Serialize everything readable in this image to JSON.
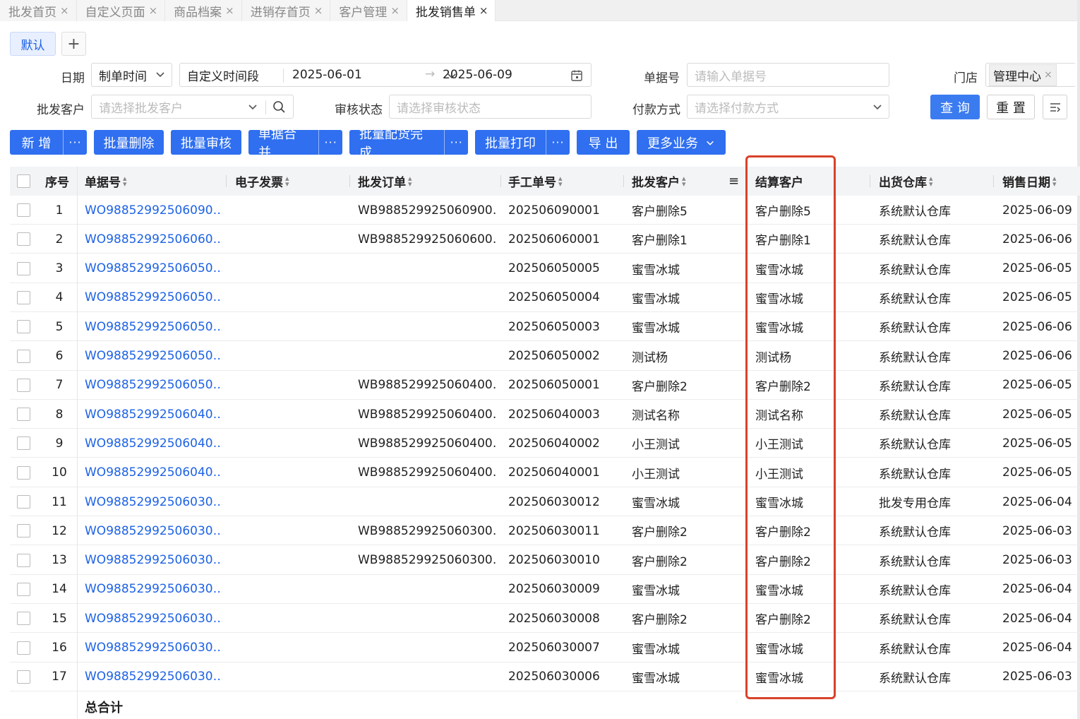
{
  "tabs": [
    {
      "label": "批发首页",
      "active": false
    },
    {
      "label": "自定义页面",
      "active": false
    },
    {
      "label": "商品档案",
      "active": false
    },
    {
      "label": "进销存首页",
      "active": false
    },
    {
      "label": "客户管理",
      "active": false
    },
    {
      "label": "批发销售单",
      "active": true
    }
  ],
  "tab_close": "×",
  "view": {
    "default_label": "默认",
    "add_label": "+"
  },
  "filters": {
    "date_label": "日期",
    "date_type": "制单时间",
    "date_range_type": "自定义时间段",
    "date_start": "2025-06-01",
    "date_arrow": "→",
    "date_end": "2025-06-09",
    "doc_no_label": "单据号",
    "doc_no_placeholder": "请输入单据号",
    "store_label": "门店",
    "store_value": "管理中心",
    "store_close": "×",
    "customer_label": "批发客户",
    "customer_placeholder": "请选择批发客户",
    "audit_label": "审核状态",
    "audit_placeholder": "请选择审核状态",
    "payment_label": "付款方式",
    "payment_placeholder": "请选择付款方式",
    "query": "查 询",
    "reset": "重 置"
  },
  "toolbar": {
    "add": "新 增",
    "batch_delete": "批量删除",
    "batch_audit": "批量审核",
    "merge": "单据合并",
    "batch_allocate": "批量配货完成",
    "batch_print": "批量打印",
    "export": "导 出",
    "more_business": "更多业务",
    "more_dots": "···"
  },
  "table": {
    "headers": {
      "seq": "序号",
      "doc_no": "单据号",
      "invoice": "电子发票",
      "order": "批发订单",
      "manual_no": "手工单号",
      "customer": "批发客户",
      "settle_customer": "结算客户",
      "warehouse": "出货仓库",
      "sale_date": "销售日期"
    },
    "rows": [
      {
        "seq": "1",
        "doc_no": "WO98852992506090…",
        "invoice": "",
        "order": "WB988529925060900…",
        "manual_no": "202506090001",
        "customer": "客户删除5",
        "settle": "客户删除5",
        "warehouse": "系统默认仓库",
        "date": "2025-06-09"
      },
      {
        "seq": "2",
        "doc_no": "WO98852992506060…",
        "invoice": "",
        "order": "WB988529925060600…",
        "manual_no": "202506060001",
        "customer": "客户删除1",
        "settle": "客户删除1",
        "warehouse": "系统默认仓库",
        "date": "2025-06-06"
      },
      {
        "seq": "3",
        "doc_no": "WO98852992506050…",
        "invoice": "",
        "order": "",
        "manual_no": "202506050005",
        "customer": "蜜雪冰城",
        "settle": "蜜雪冰城",
        "warehouse": "系统默认仓库",
        "date": "2025-06-05"
      },
      {
        "seq": "4",
        "doc_no": "WO98852992506050…",
        "invoice": "",
        "order": "",
        "manual_no": "202506050004",
        "customer": "蜜雪冰城",
        "settle": "蜜雪冰城",
        "warehouse": "系统默认仓库",
        "date": "2025-06-05"
      },
      {
        "seq": "5",
        "doc_no": "WO98852992506050…",
        "invoice": "",
        "order": "",
        "manual_no": "202506050003",
        "customer": "蜜雪冰城",
        "settle": "蜜雪冰城",
        "warehouse": "系统默认仓库",
        "date": "2025-06-06"
      },
      {
        "seq": "6",
        "doc_no": "WO98852992506050…",
        "invoice": "",
        "order": "",
        "manual_no": "202506050002",
        "customer": "测试杨",
        "settle": "测试杨",
        "warehouse": "系统默认仓库",
        "date": "2025-06-06"
      },
      {
        "seq": "7",
        "doc_no": "WO98852992506050…",
        "invoice": "",
        "order": "WB988529925060400…",
        "manual_no": "202506050001",
        "customer": "客户删除2",
        "settle": "客户删除2",
        "warehouse": "系统默认仓库",
        "date": "2025-06-05"
      },
      {
        "seq": "8",
        "doc_no": "WO98852992506040…",
        "invoice": "",
        "order": "WB988529925060400…",
        "manual_no": "202506040003",
        "customer": "测试名称",
        "settle": "测试名称",
        "warehouse": "系统默认仓库",
        "date": "2025-06-05"
      },
      {
        "seq": "9",
        "doc_no": "WO98852992506040…",
        "invoice": "",
        "order": "WB988529925060400…",
        "manual_no": "202506040002",
        "customer": "小王测试",
        "settle": "小王测试",
        "warehouse": "系统默认仓库",
        "date": "2025-06-05"
      },
      {
        "seq": "10",
        "doc_no": "WO98852992506040…",
        "invoice": "",
        "order": "WB988529925060400…",
        "manual_no": "202506040001",
        "customer": "小王测试",
        "settle": "小王测试",
        "warehouse": "系统默认仓库",
        "date": "2025-06-05"
      },
      {
        "seq": "11",
        "doc_no": "WO98852992506030…",
        "invoice": "",
        "order": "",
        "manual_no": "202506030012",
        "customer": "蜜雪冰城",
        "settle": "蜜雪冰城",
        "warehouse": "批发专用仓库",
        "date": "2025-06-04"
      },
      {
        "seq": "12",
        "doc_no": "WO98852992506030…",
        "invoice": "",
        "order": "WB988529925060300…",
        "manual_no": "202506030011",
        "customer": "客户删除2",
        "settle": "客户删除2",
        "warehouse": "系统默认仓库",
        "date": "2025-06-03"
      },
      {
        "seq": "13",
        "doc_no": "WO98852992506030…",
        "invoice": "",
        "order": "WB988529925060300…",
        "manual_no": "202506030010",
        "customer": "客户删除2",
        "settle": "客户删除2",
        "warehouse": "系统默认仓库",
        "date": "2025-06-03"
      },
      {
        "seq": "14",
        "doc_no": "WO98852992506030…",
        "invoice": "",
        "order": "",
        "manual_no": "202506030009",
        "customer": "蜜雪冰城",
        "settle": "蜜雪冰城",
        "warehouse": "系统默认仓库",
        "date": "2025-06-04"
      },
      {
        "seq": "15",
        "doc_no": "WO98852992506030…",
        "invoice": "",
        "order": "",
        "manual_no": "202506030008",
        "customer": "客户删除2",
        "settle": "客户删除2",
        "warehouse": "系统默认仓库",
        "date": "2025-06-04"
      },
      {
        "seq": "16",
        "doc_no": "WO98852992506030…",
        "invoice": "",
        "order": "",
        "manual_no": "202506030007",
        "customer": "蜜雪冰城",
        "settle": "蜜雪冰城",
        "warehouse": "系统默认仓库",
        "date": "2025-06-04"
      },
      {
        "seq": "17",
        "doc_no": "WO98852992506030…",
        "invoice": "",
        "order": "",
        "manual_no": "202506030006",
        "customer": "蜜雪冰城",
        "settle": "蜜雪冰城",
        "warehouse": "系统默认仓库",
        "date": "2025-06-03"
      }
    ],
    "total_label": "总合计"
  },
  "colors": {
    "primary": "#2f6ff0",
    "link": "#1d62e6",
    "highlight": "#d9422b"
  }
}
